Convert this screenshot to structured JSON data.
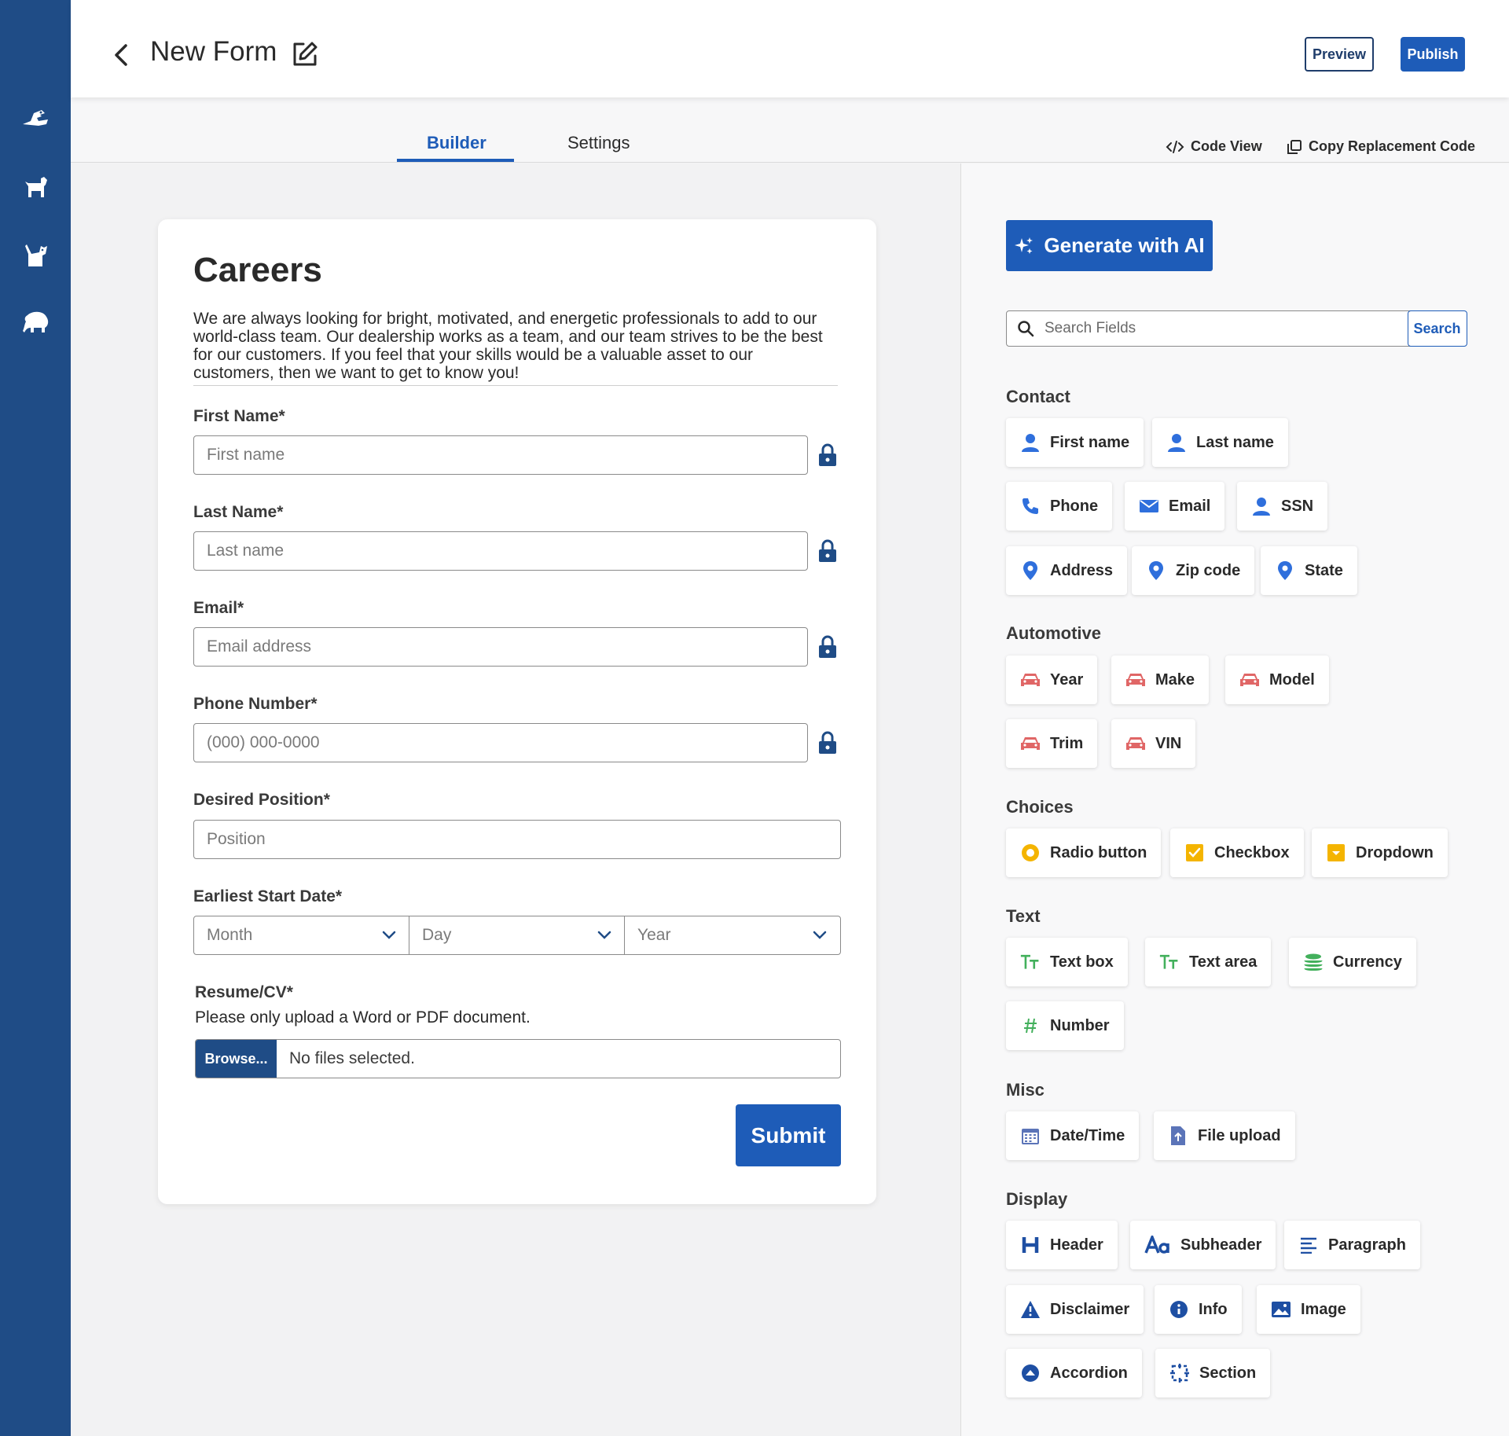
{
  "header": {
    "title": "New Form",
    "preview_label": "Preview",
    "publish_label": "Publish"
  },
  "tabs": {
    "builder": "Builder",
    "settings": "Settings",
    "code_view": "Code View",
    "copy_code": "Copy Replacement Code"
  },
  "form": {
    "title": "Careers",
    "description": "We are always looking for bright, motivated, and energetic professionals to add to our world-class team. Our dealership works as a team, and our team strives to be the best for our customers. If you feel that your skills would be a valuable asset to our customers, then we want to get to know you!",
    "first_name": {
      "label": "First Name*",
      "placeholder": "First name"
    },
    "last_name": {
      "label": "Last Name*",
      "placeholder": "Last name"
    },
    "email": {
      "label": "Email*",
      "placeholder": "Email address"
    },
    "phone": {
      "label": "Phone Number*",
      "placeholder": "(000) 000-0000"
    },
    "position": {
      "label": "Desired Position*",
      "placeholder": "Position"
    },
    "start_date": {
      "label": "Earliest Start Date*",
      "month": "Month",
      "day": "Day",
      "year": "Year"
    },
    "resume": {
      "label": "Resume/CV*",
      "hint": "Please only upload a Word or PDF document.",
      "browse": "Browse...",
      "status": "No files selected."
    },
    "submit_label": "Submit"
  },
  "panel": {
    "ai_button": "Generate with AI",
    "search_placeholder": "Search Fields",
    "search_button": "Search",
    "groups": {
      "contact": "Contact",
      "automotive": "Automotive",
      "choices": "Choices",
      "text": "Text",
      "misc": "Misc",
      "display": "Display"
    },
    "fields": {
      "first_name": "First name",
      "last_name": "Last name",
      "phone": "Phone",
      "email": "Email",
      "ssn": "SSN",
      "address": "Address",
      "zip": "Zip code",
      "state": "State",
      "year": "Year",
      "make": "Make",
      "model": "Model",
      "trim": "Trim",
      "vin": "VIN",
      "radio": "Radio button",
      "checkbox": "Checkbox",
      "dropdown": "Dropdown",
      "text_box": "Text box",
      "text_area": "Text area",
      "currency": "Currency",
      "number": "Number",
      "datetime": "Date/Time",
      "file_upload": "File upload",
      "header": "Header",
      "subheader": "Subheader",
      "paragraph": "Paragraph",
      "disclaimer": "Disclaimer",
      "info": "Info",
      "image": "Image",
      "accordion": "Accordion",
      "section": "Section"
    }
  },
  "colors": {
    "rail": "#1f4c86",
    "primary": "#1e5cb8",
    "contact_icon": "#2f6fdc",
    "automotive_icon": "#e06666",
    "choice_icon": "#f4b400",
    "text_icon": "#43b05c"
  },
  "icons": {
    "rail": [
      "bird-icon",
      "dog-icon",
      "cat-icon",
      "elephant-icon"
    ]
  }
}
